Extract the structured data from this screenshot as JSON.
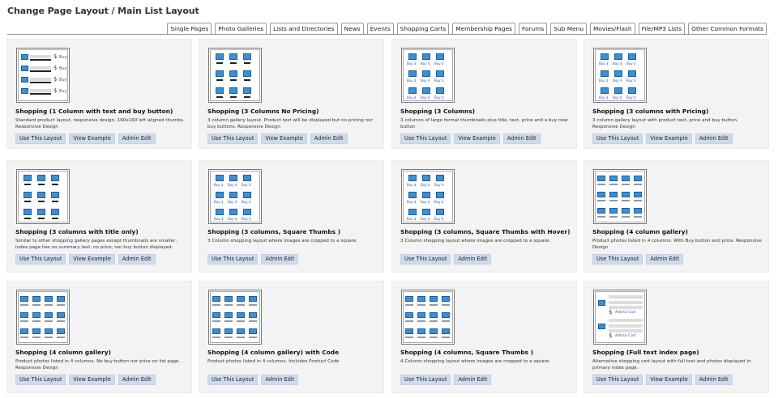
{
  "page": {
    "title": "Change Page Layout / Main List Layout"
  },
  "tabs": [
    "Single Pages",
    "Photo Galleries",
    "Lists and Directories",
    "News",
    "Events",
    "Shopping Carts",
    "Membership Pages",
    "Forums",
    "Sub Menu",
    "Movies/Flash",
    "File/MP3 Lists",
    "Other Common Formats"
  ],
  "buttons": {
    "use": "Use This Layout",
    "example": "View Example",
    "admin": "Admin Edit"
  },
  "thumb_labels": {
    "buy": "Buy",
    "buy_dollar": "Buy $",
    "dollar": "$",
    "add_to_cart": "Add to Cart"
  },
  "layouts": [
    {
      "title": "Shopping (1 Column with text and buy button)",
      "desc": "Standard product layout, responsive design, 160x160 left aligned thumbs. Responsive Design",
      "thumb": "list-buy",
      "example": true
    },
    {
      "title": "Shopping (3 Columns No Pricing)",
      "desc": "3 column gallery layout. Product text will be displayed but no pricing nor buy buttons. Responsive Design",
      "thumb": "grid3-lines",
      "example": true
    },
    {
      "title": "Shopping (3 Columns)",
      "desc": "3 columns of large format thumbnails plus title, text, price and a buy now button",
      "thumb": "grid3-buy",
      "example": true
    },
    {
      "title": "Shopping (3 columns with Pricing)",
      "desc": "3 column gallery layout with product text, price and buy button. Responsive Design",
      "thumb": "grid3-buy",
      "example": true
    },
    {
      "title": "Shopping (3 columns with title only)",
      "desc": "Similar to other shopping gallery pages except thumbnails are smaller, index page has no summary text, no price, nor buy button displayed.",
      "thumb": "grid3-lines",
      "example": true
    },
    {
      "title": "Shopping (3 columns, Square Thumbs )",
      "desc": "3 Column shopping layout where images are cropped to a square.",
      "thumb": "grid3-buy",
      "example": false
    },
    {
      "title": "Shopping (3 columns, Square Thumbs with Hover)",
      "desc": "3 Column shopping layout where images are cropped to a square.",
      "thumb": "grid3-buy",
      "example": false
    },
    {
      "title": "Shopping (4 column gallery)",
      "desc": "Product photos listed in 4 columns. With Buy button and price. Responsive Design",
      "thumb": "grid4",
      "example": false
    },
    {
      "title": "Shopping (4 column gallery)",
      "desc": "Product photos listed in 4 columns. No buy button nor price on list page. Responsive Design",
      "thumb": "grid4",
      "example": true
    },
    {
      "title": "Shopping (4 column gallery) with Code",
      "desc": "Product photos listed in 4 columns. Includes Product Code",
      "thumb": "grid4",
      "example": false
    },
    {
      "title": "Shopping (4 columns, Square Thumbs )",
      "desc": "4 Column shopping layout where images are cropped to a square.",
      "thumb": "grid4",
      "example": false
    },
    {
      "title": "Shopping (Full text index page)",
      "desc": "Alternative shopping cart layout with full text and photos displayed in primary index page.",
      "thumb": "fulltext",
      "example": true
    }
  ],
  "colors": {
    "button_bg": "#cfdaea",
    "card_bg": "#f3f3f3",
    "thumb_blue": "#3b8fd6",
    "link_blue": "#3a4fb8"
  }
}
